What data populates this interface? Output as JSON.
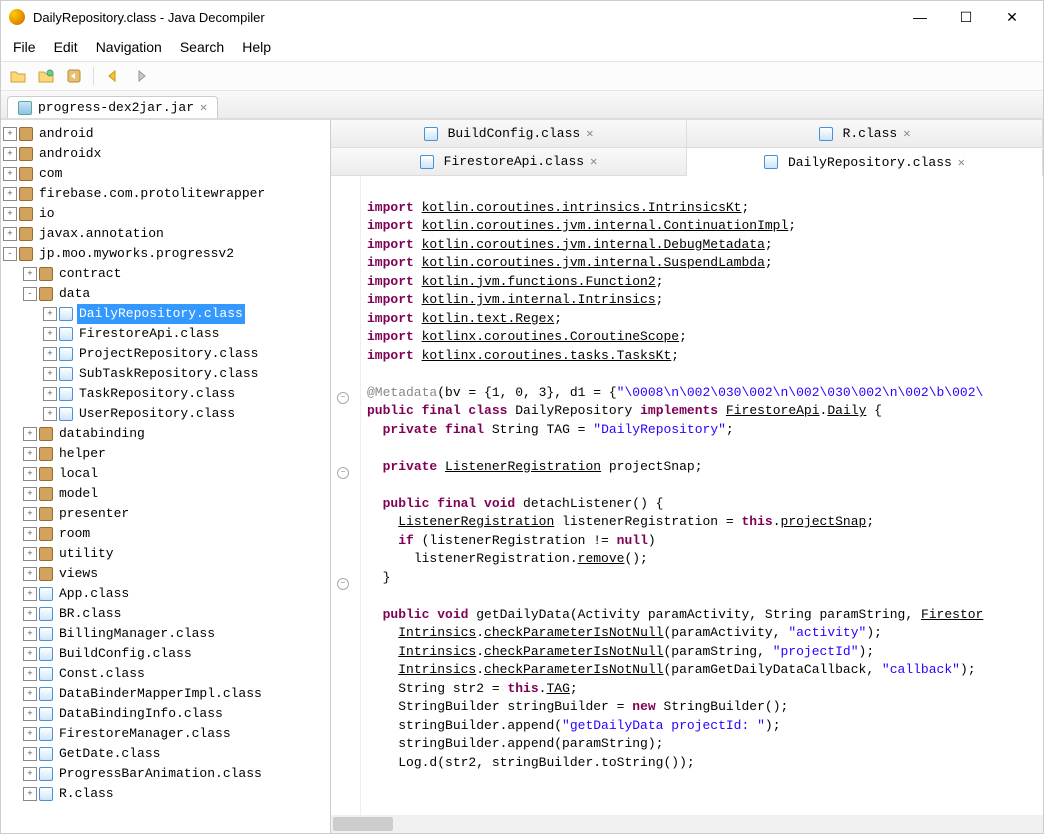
{
  "window": {
    "title": "DailyRepository.class - Java Decompiler"
  },
  "menubar": [
    "File",
    "Edit",
    "Navigation",
    "Search",
    "Help"
  ],
  "project_tab": "progress-dex2jar.jar",
  "tree": [
    {
      "d": 0,
      "e": "+",
      "t": "pkg",
      "l": "android"
    },
    {
      "d": 0,
      "e": "+",
      "t": "pkg",
      "l": "androidx"
    },
    {
      "d": 0,
      "e": "+",
      "t": "pkg",
      "l": "com"
    },
    {
      "d": 0,
      "e": "+",
      "t": "pkg",
      "l": "firebase.com.protolitewrapper"
    },
    {
      "d": 0,
      "e": "+",
      "t": "pkg",
      "l": "io"
    },
    {
      "d": 0,
      "e": "+",
      "t": "pkg",
      "l": "javax.annotation"
    },
    {
      "d": 0,
      "e": "-",
      "t": "pkg",
      "l": "jp.moo.myworks.progressv2"
    },
    {
      "d": 1,
      "e": "+",
      "t": "pkg",
      "l": "contract"
    },
    {
      "d": 1,
      "e": "-",
      "t": "pkg",
      "l": "data"
    },
    {
      "d": 2,
      "e": "+",
      "t": "cls",
      "l": "DailyRepository.class",
      "sel": true
    },
    {
      "d": 2,
      "e": "+",
      "t": "cls",
      "l": "FirestoreApi.class"
    },
    {
      "d": 2,
      "e": "+",
      "t": "cls",
      "l": "ProjectRepository.class"
    },
    {
      "d": 2,
      "e": "+",
      "t": "cls",
      "l": "SubTaskRepository.class"
    },
    {
      "d": 2,
      "e": "+",
      "t": "cls",
      "l": "TaskRepository.class"
    },
    {
      "d": 2,
      "e": "+",
      "t": "cls",
      "l": "UserRepository.class"
    },
    {
      "d": 1,
      "e": "+",
      "t": "pkg",
      "l": "databinding"
    },
    {
      "d": 1,
      "e": "+",
      "t": "pkg",
      "l": "helper"
    },
    {
      "d": 1,
      "e": "+",
      "t": "pkg",
      "l": "local"
    },
    {
      "d": 1,
      "e": "+",
      "t": "pkg",
      "l": "model"
    },
    {
      "d": 1,
      "e": "+",
      "t": "pkg",
      "l": "presenter"
    },
    {
      "d": 1,
      "e": "+",
      "t": "pkg",
      "l": "room"
    },
    {
      "d": 1,
      "e": "+",
      "t": "pkg",
      "l": "utility"
    },
    {
      "d": 1,
      "e": "+",
      "t": "pkg",
      "l": "views"
    },
    {
      "d": 1,
      "e": "+",
      "t": "cls",
      "l": "App.class"
    },
    {
      "d": 1,
      "e": "+",
      "t": "cls",
      "l": "BR.class"
    },
    {
      "d": 1,
      "e": "+",
      "t": "cls",
      "l": "BillingManager.class"
    },
    {
      "d": 1,
      "e": "+",
      "t": "cls",
      "l": "BuildConfig.class"
    },
    {
      "d": 1,
      "e": "+",
      "t": "cls",
      "l": "Const.class"
    },
    {
      "d": 1,
      "e": "+",
      "t": "cls",
      "l": "DataBinderMapperImpl.class"
    },
    {
      "d": 1,
      "e": "+",
      "t": "cls",
      "l": "DataBindingInfo.class"
    },
    {
      "d": 1,
      "e": "+",
      "t": "cls",
      "l": "FirestoreManager.class"
    },
    {
      "d": 1,
      "e": "+",
      "t": "cls",
      "l": "GetDate.class"
    },
    {
      "d": 1,
      "e": "+",
      "t": "cls",
      "l": "ProgressBarAnimation.class"
    },
    {
      "d": 1,
      "e": "+",
      "t": "cls",
      "l": "R.class"
    }
  ],
  "editor_tabs_row1": [
    {
      "l": "BuildConfig.class",
      "a": false
    },
    {
      "l": "R.class",
      "a": false
    }
  ],
  "editor_tabs_row2": [
    {
      "l": "FirestoreApi.class",
      "a": false
    },
    {
      "l": "DailyRepository.class",
      "a": true
    }
  ],
  "code": {
    "imports": [
      "kotlin.coroutines.intrinsics.IntrinsicsKt",
      "kotlin.coroutines.jvm.internal.ContinuationImpl",
      "kotlin.coroutines.jvm.internal.DebugMetadata",
      "kotlin.coroutines.jvm.internal.SuspendLambda",
      "kotlin.jvm.functions.Function2",
      "kotlin.jvm.internal.Intrinsics",
      "kotlin.text.Regex",
      "kotlinx.coroutines.CoroutineScope",
      "kotlinx.coroutines.tasks.TasksKt"
    ],
    "metadata_prefix": "@Metadata",
    "metadata_args": "(bv = {1, 0, 3}, d1 = {",
    "metadata_str": "\"\\0008\\n\\002\\030\\002\\n\\002\\030\\002\\n\\002\\b\\002\\",
    "class_decl": {
      "mods": "public final class",
      "name": "DailyRepository",
      "impl": "implements",
      "iface": "FirestoreApi",
      "member": "Daily"
    },
    "tag_line": {
      "mods": "private final",
      "type": "String",
      "name": "TAG =",
      "val": "\"DailyRepository\""
    },
    "snap_line": {
      "mods": "private",
      "type": "ListenerRegistration",
      "name": "projectSnap;"
    },
    "detach": {
      "sig_mods": "public final void",
      "sig_name": "detachListener() {",
      "l1_type": "ListenerRegistration",
      "l1_rest": " listenerRegistration = ",
      "l1_this": "this",
      "l1_field": "projectSnap",
      "l2_if": "if",
      "l2_cond": " (listenerRegistration != ",
      "l2_null": "null",
      "l2_close": ")",
      "l3_call": "listenerRegistration.",
      "l3_method": "remove",
      "l3_end": "();"
    },
    "getdaily": {
      "sig_mods": "public void",
      "sig_name": "getDailyData(Activity paramActivity, String paramString, ",
      "sig_tail": "Firestor",
      "check1_cls": "Intrinsics",
      "check1_m": "checkParameterIsNotNull",
      "check1_args": "(paramActivity, ",
      "check1_str": "\"activity\"",
      "check1_end": ");",
      "check2_cls": "Intrinsics",
      "check2_m": "checkParameterIsNotNull",
      "check2_args": "(paramString, ",
      "check2_str": "\"projectId\"",
      "check2_end": ");",
      "check3_cls": "Intrinsics",
      "check3_m": "checkParameterIsNotNull",
      "check3_args": "(paramGetDailyDataCallback, ",
      "check3_str": "\"callback\"",
      "check3_end": ");",
      "s1": "String str2 = ",
      "s1_this": "this",
      "s1_dot": ".",
      "s1_tag": "TAG",
      "s1_end": ";",
      "s2": "StringBuilder stringBuilder = ",
      "s2_new": "new",
      "s2_end": " StringBuilder();",
      "s3": "stringBuilder.append(",
      "s3_str": "\"getDailyData projectId: \"",
      "s3_end": ");",
      "s4": "stringBuilder.append(paramString);",
      "s5": "Log.d(str2, stringBuilder.toString());"
    }
  }
}
